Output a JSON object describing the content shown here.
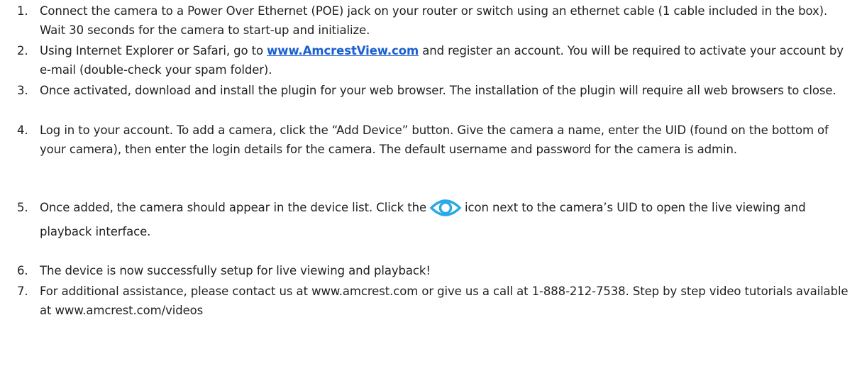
{
  "steps": [
    {
      "number": "1.",
      "text": "Connect the camera to a Power Over Ethernet (POE) jack on your router or switch using an ethernet cable (1 cable included in the box). Wait 30 seconds for the camera to start-up and initialize."
    },
    {
      "number": "2.",
      "text_before": "Using Internet Explorer or Safari, go to ",
      "link": "www.AmcrestView.com",
      "text_after": " and register an account. You will be required to activate your account by e-mail (double-check your spam folder)."
    },
    {
      "number": "3.",
      "text": "Once activated, download and install the plugin for your web browser. The installation of the plugin will require all web browsers to close."
    },
    {
      "number": "4.",
      "text": "Log in to your account. To add a camera, click the “Add Device” button. Give the camera a name, enter the UID (found on the bottom of your camera), then enter the login details for the camera. The default username and password for the camera is admin."
    },
    {
      "number": "5.",
      "text_before": "Once added, the camera should appear in the device list. Click the",
      "icon": "eye-icon",
      "text_after": "icon next to the camera’s UID to open the live viewing and playback interface."
    },
    {
      "number": "6.",
      "text": "The device is now successfully setup for live viewing and playback!"
    },
    {
      "number": "7.",
      "text": "For additional assistance, please contact us at www.amcrest.com or give us a call at 1-888-212-7538. Step by step video tutorials available at www.amcrest.com/videos"
    }
  ],
  "colors": {
    "text": "#222222",
    "link": "#1a5fd0",
    "eye_icon": "#29a9e8"
  }
}
